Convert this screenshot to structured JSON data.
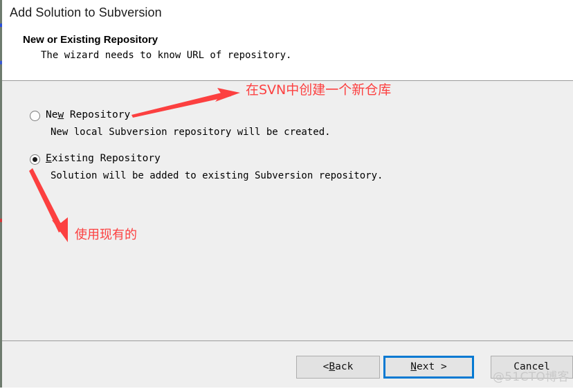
{
  "window": {
    "title": "Add Solution to Subversion"
  },
  "header": {
    "heading": "New or Existing Repository",
    "subtitle": "The wizard needs to know URL of repository."
  },
  "options": [
    {
      "id": "new-repository",
      "label_before": "Ne",
      "label_accel": "w",
      "label_after": " Repository",
      "description": "New local Subversion repository will be created.",
      "selected": false
    },
    {
      "id": "existing-repository",
      "label_before": "",
      "label_accel": "E",
      "label_after": "xisting Repository",
      "description": "Solution will be added to existing Subversion repository.",
      "selected": true
    }
  ],
  "annotations": [
    {
      "id": "new-repo-annotation",
      "text": "在SVN中创建一个新仓库",
      "color": "#fc4040",
      "arrow": "points-up-right-to-new-repository-radio"
    },
    {
      "id": "existing-repo-annotation",
      "text": "使用现有的",
      "color": "#fc4040",
      "arrow": "points-up-left-to-existing-repository-radio"
    }
  ],
  "buttons": [
    {
      "id": "back",
      "prefix": "< ",
      "accel": "B",
      "suffix": "ack",
      "focused": false
    },
    {
      "id": "next",
      "prefix": "",
      "accel": "N",
      "suffix": "ext >",
      "focused": true
    },
    {
      "id": "cancel",
      "prefix": "",
      "accel": "",
      "suffix": "Cancel",
      "focused": false
    }
  ],
  "watermark": {
    "text": "@51CTO博客"
  },
  "colors": {
    "focus_border": "#0479d2",
    "annotation_red": "#fc4040",
    "dialog_background": "#efefef",
    "header_background": "#ffffff"
  }
}
